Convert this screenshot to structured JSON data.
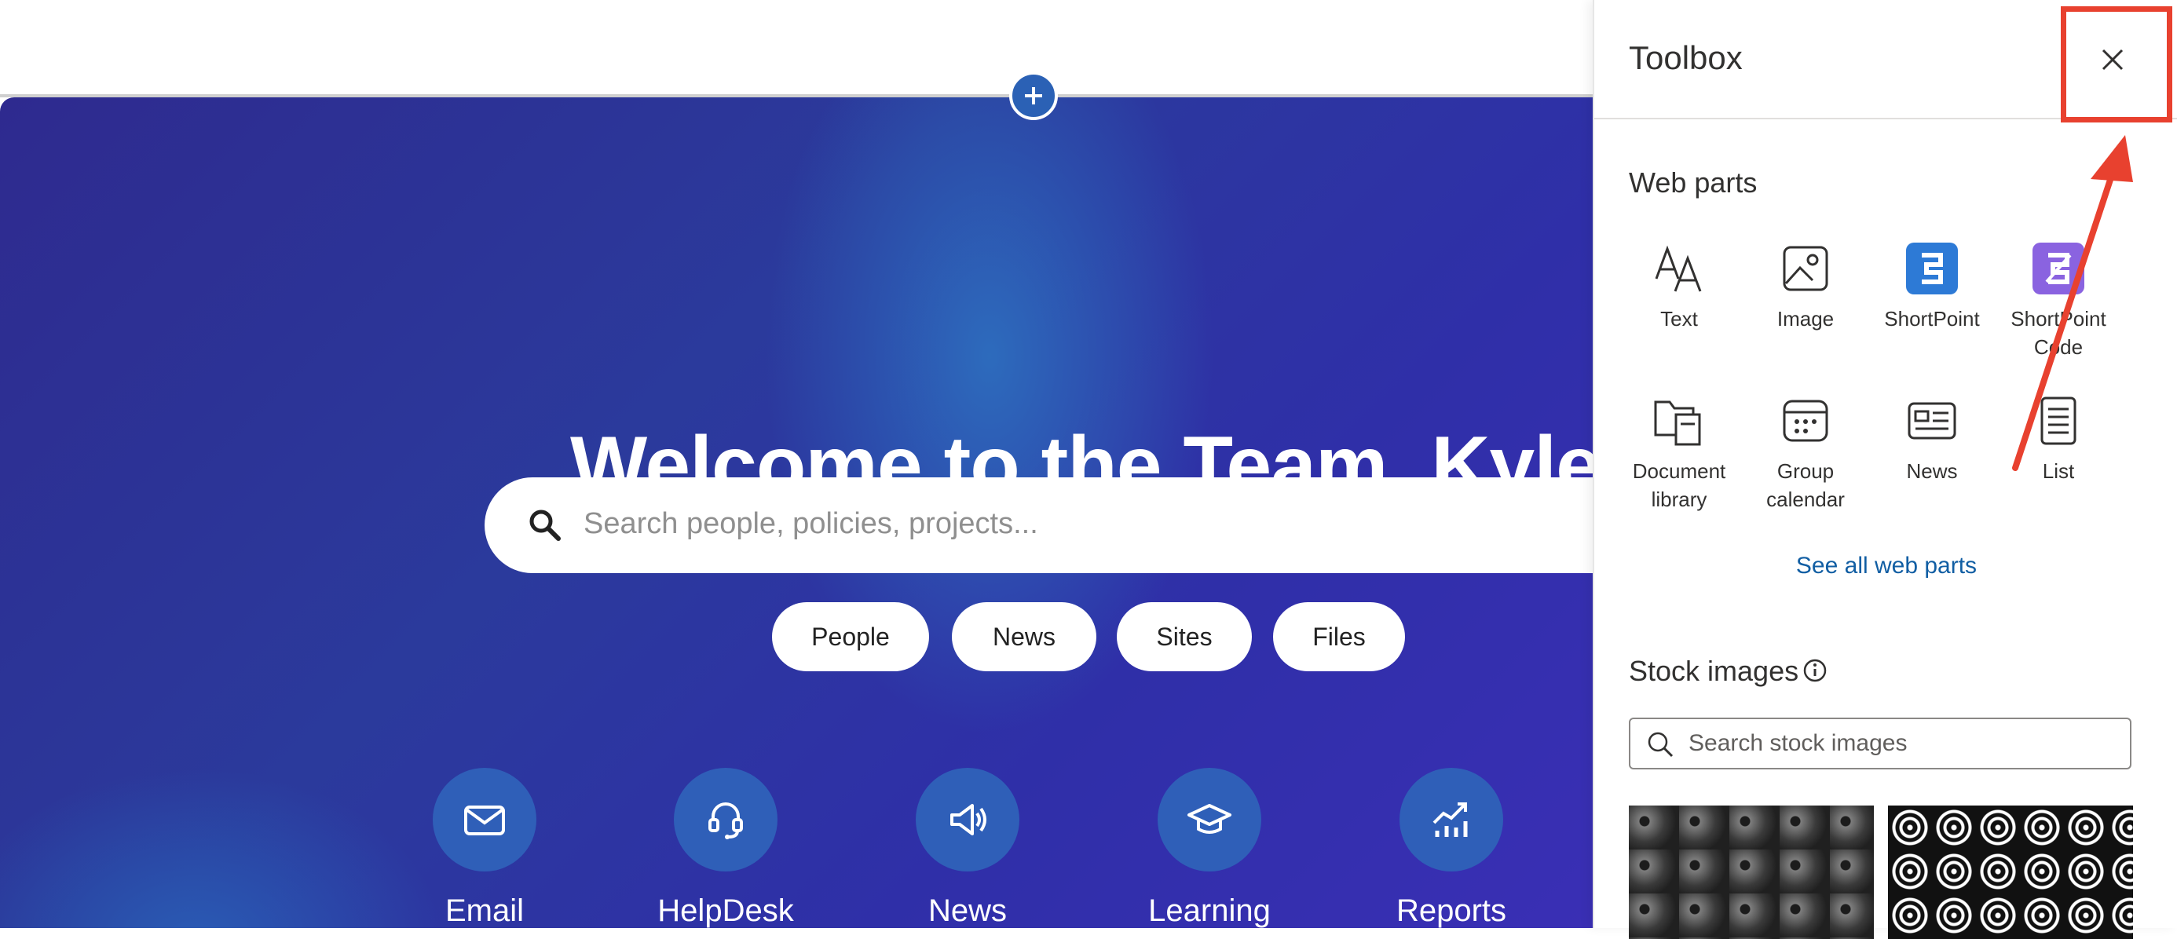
{
  "hero": {
    "title": "Welcome to the Team, Kyle!",
    "search_placeholder": "Search people, policies, projects...",
    "filters": [
      "People",
      "News",
      "Sites",
      "Files"
    ],
    "quick_links": [
      "Email",
      "HelpDesk",
      "News",
      "Learning",
      "Reports"
    ]
  },
  "toolbox": {
    "title": "Toolbox",
    "web_parts_heading": "Web parts",
    "web_parts": [
      "Text",
      "Image",
      "ShortPoint",
      "ShortPoint Code",
      "Document library",
      "Group calendar",
      "News",
      "List"
    ],
    "see_all": "See all web parts",
    "stock_heading": "Stock images",
    "stock_search_placeholder": "Search stock images"
  },
  "colors": {
    "accent_link": "#115ea3",
    "annotation": "#e8412f",
    "hero_dark": "#2e2a8f"
  }
}
